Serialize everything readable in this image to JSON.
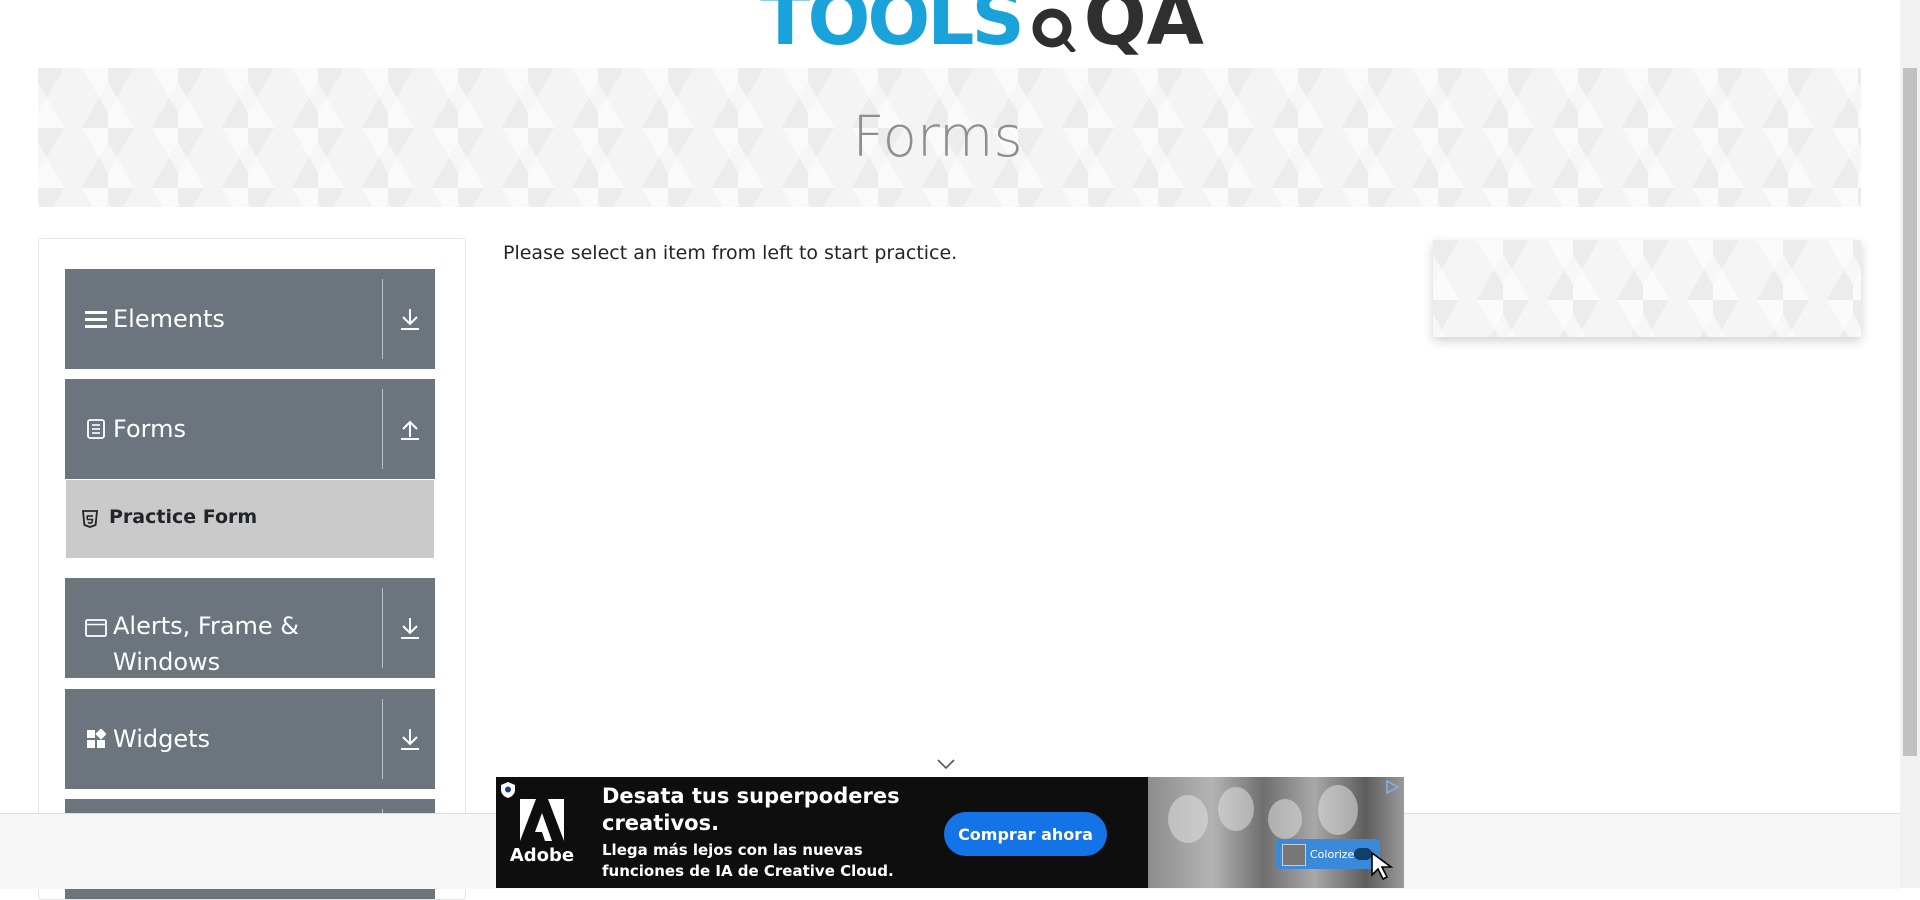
{
  "logo": {
    "part1": "TOOLS",
    "part2": "QA"
  },
  "banner": {
    "title": "Forms"
  },
  "sidebar": {
    "groups": [
      {
        "label": "Elements",
        "icon": "hamburger-icon",
        "state": "collapsed",
        "toggle_icon": "download-arrow-icon"
      },
      {
        "label": "Forms",
        "icon": "document-icon",
        "state": "expanded",
        "toggle_icon": "upload-arrow-icon",
        "items": [
          {
            "label": "Practice Form",
            "icon": "html5-icon"
          }
        ]
      },
      {
        "label": "Alerts, Frame & Windows",
        "icon": "window-icon",
        "state": "collapsed",
        "toggle_icon": "download-arrow-icon"
      },
      {
        "label": "Widgets",
        "icon": "widgets-icon",
        "state": "collapsed",
        "toggle_icon": "download-arrow-icon"
      }
    ]
  },
  "main": {
    "instruction": "Please select an item from left to start practice."
  },
  "ad": {
    "brand": "Adobe",
    "headline": "Desata tus superpoderes creativos.",
    "subtext": "Llega más lejos con las nuevas funciones de IA de Creative Cloud.",
    "cta": "Comprar ahora",
    "chip_label": "Colorize"
  },
  "colors": {
    "sidebar_group_bg": "#6c757d",
    "sidebar_item_active_bg": "#cacaca",
    "logo_blue": "#1aa3da",
    "logo_dark": "#2f2f2f",
    "cta_blue": "#1473e6",
    "banner_title": "#8e8e8e"
  }
}
